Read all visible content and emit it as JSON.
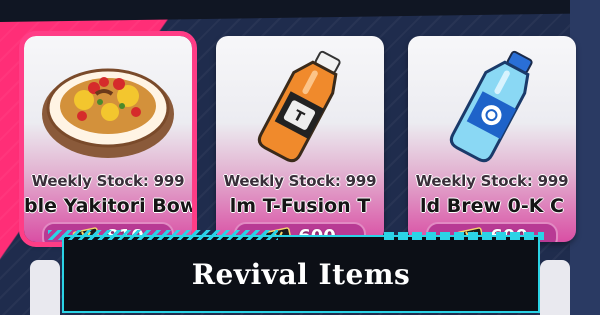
{
  "shop": {
    "items": [
      {
        "name": "ble Yakitori Bow",
        "stock_label": "Weekly Stock: 999",
        "price": "810",
        "selected": true,
        "icon": "yakitori-bowl-icon"
      },
      {
        "name": "lm T-Fusion   T",
        "stock_label": "Weekly Stock: 999",
        "price": "600",
        "selected": false,
        "icon": "orange-drink-bottle-icon"
      },
      {
        "name": "ld Brew   0-K C",
        "stock_label": "Weekly Stock: 999",
        "price": "600",
        "selected": false,
        "icon": "blue-water-bottle-icon"
      }
    ],
    "currency_icon": "ticket-icon"
  },
  "banner": {
    "title": "Revival Items"
  },
  "colors": {
    "accent_pink": "#ff3d86",
    "price_pill": "#b83a94",
    "banner_border": "#2bd3e6"
  }
}
